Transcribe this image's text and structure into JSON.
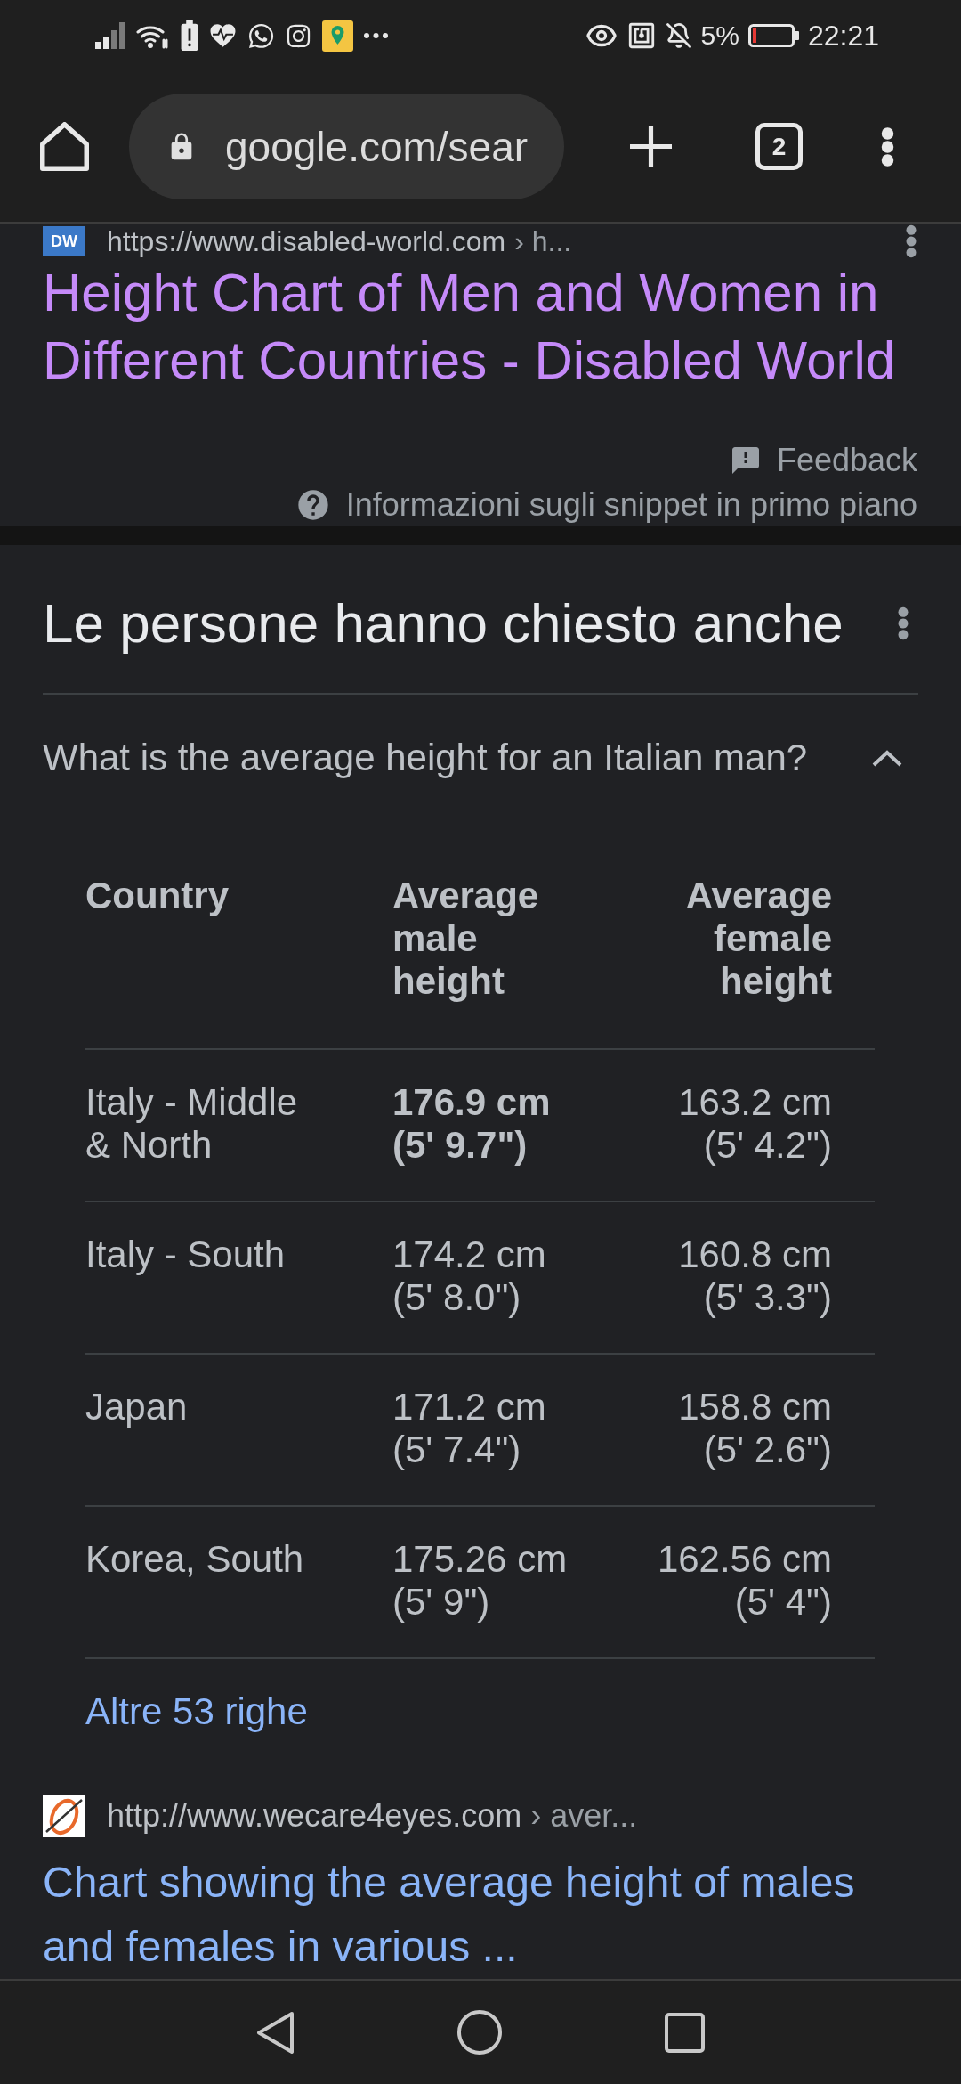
{
  "status_bar": {
    "battery": "5%",
    "time": "22:21"
  },
  "browser": {
    "url": "google.com/sear",
    "tab_count": "2"
  },
  "featured_result": {
    "favicon_label": "DW",
    "url": "https://www.disabled-world.com",
    "breadcrumb": "› h...",
    "title": "Height Chart of Men and Women in Different Countries - Disabled World",
    "visited": true,
    "feedback": "Feedback",
    "snippet_info": "Informazioni sugli snippet in primo piano"
  },
  "people_also_ask": {
    "title": "Le persone hanno chiesto anche",
    "questions": [
      {
        "question": "What is the average height for an Italian man?",
        "expanded": true,
        "table": {
          "columns": [
            "Country",
            "Average male height",
            "Average female height"
          ],
          "rows": [
            {
              "cells": [
                {
                  "text": "Italy - Middle & North",
                  "bold": false
                },
                {
                  "text": "176.9 cm (5' 9.7\")",
                  "bold": true
                },
                {
                  "text": "163.2 cm (5' 4.2\")",
                  "bold": false
                }
              ]
            },
            {
              "cells": [
                {
                  "text": "Italy - South",
                  "bold": false
                },
                {
                  "text": "174.2 cm (5' 8.0\")",
                  "bold": false
                },
                {
                  "text": "160.8 cm (5' 3.3\")",
                  "bold": false
                }
              ]
            },
            {
              "cells": [
                {
                  "text": "Japan",
                  "bold": false
                },
                {
                  "text": "171.2 cm (5' 7.4\")",
                  "bold": false
                },
                {
                  "text": "158.8 cm (5' 2.6\")",
                  "bold": false
                }
              ]
            },
            {
              "cells": [
                {
                  "text": "Korea, South",
                  "bold": false
                },
                {
                  "text": "175.26 cm (5' 9\")",
                  "bold": false
                },
                {
                  "text": "162.56 cm (5' 4\")",
                  "bold": false
                }
              ]
            }
          ]
        },
        "more_rows": "Altre 53 righe"
      }
    ]
  },
  "next_result": {
    "url": "http://www.wecare4eyes.com",
    "breadcrumb": "› aver...",
    "title": "Chart showing the average height of males and females in various ...",
    "visited": false
  }
}
